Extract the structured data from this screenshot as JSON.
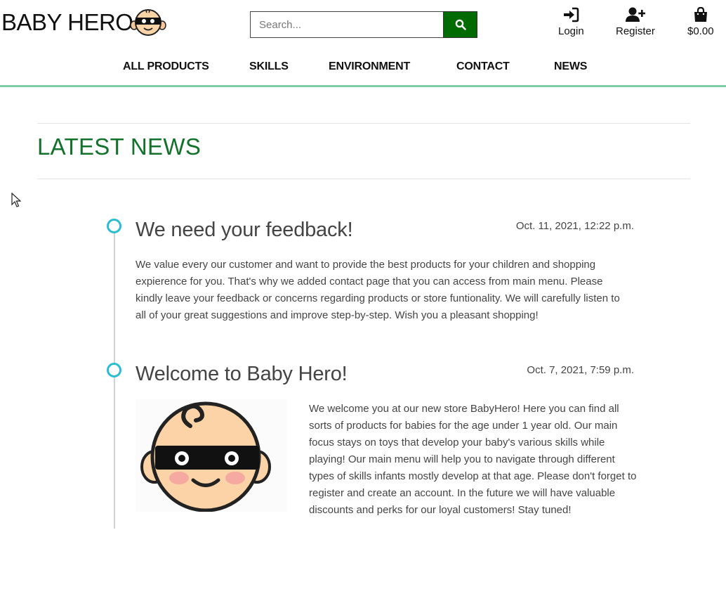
{
  "brand": {
    "name": "BABY HERO"
  },
  "search": {
    "placeholder": "Search..."
  },
  "account": {
    "login_label": "Login",
    "register_label": "Register",
    "cart_total": "$0.00"
  },
  "nav": {
    "items": [
      {
        "label": "ALL PRODUCTS"
      },
      {
        "label": "SKILLS"
      },
      {
        "label": "ENVIRONMENT"
      },
      {
        "label": "CONTACT"
      },
      {
        "label": "NEWS"
      }
    ]
  },
  "page": {
    "title": "LATEST NEWS"
  },
  "posts": [
    {
      "title": "We need your feedback!",
      "date": "Oct. 11, 2021, 12:22 p.m.",
      "body": "We value every our customer and want to provide the best products for your children and shopping expierence for you. That's why we added contact page that you can access from main menu. Please kindly leave your feedback or concerns regarding products or store funtionality. We will carefully listen to all of your great suggestions and improve step-by-step. Wish you a pleasant shopping!"
    },
    {
      "title": "Welcome to Baby Hero!",
      "date": "Oct. 7, 2021, 7:59 p.m.",
      "body": "We welcome you at our new store BabyHero! Here you can find all sorts of products for babies for the age under 1 year old. Our main focus stays on toys that develop your baby's various skills while playing! Our main menu will help you to navigate through different types of skills infants mostly develop at that age. Please don't forget to register and create an account. In the future we will have valuable discounts and perks for our loyal customers! Stay tuned!"
    }
  ],
  "colors": {
    "brand_green": "#006b00",
    "title_green": "#12722b",
    "timeline_accent": "#29bcd4",
    "header_border": "#7fcba8"
  },
  "icons": {
    "search": "search-icon",
    "login": "sign-in-icon",
    "register": "user-plus-icon",
    "cart": "shopping-bag-icon"
  }
}
